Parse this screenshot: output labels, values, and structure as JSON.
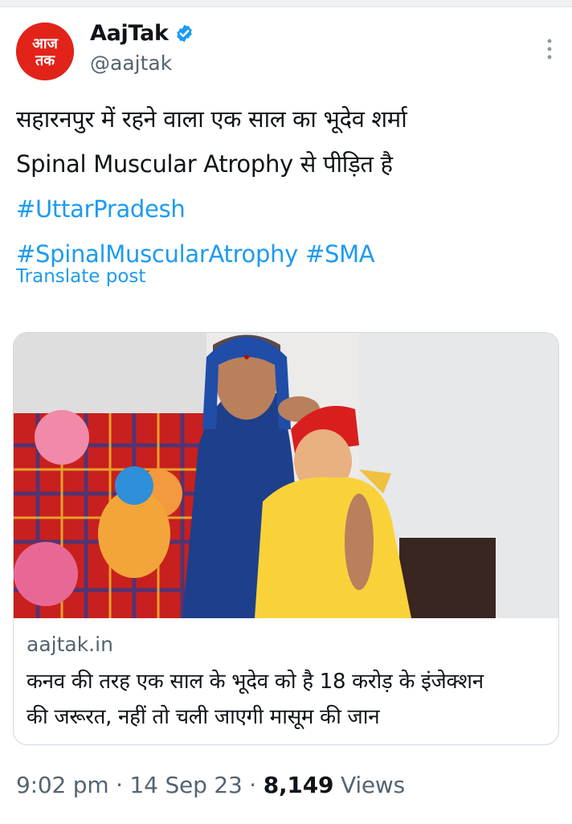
{
  "author": {
    "logo_text": "आज तक",
    "name": "AajTak",
    "handle": "@aajtak",
    "verified_icon": "verified-badge-icon",
    "more_icon": "more-vertical-icon"
  },
  "post": {
    "lines": [
      "सहारनपुर में रहने वाला एक साल का भूदेव शर्मा",
      "Spinal Muscular Atrophy से पीड़ित है"
    ],
    "hashtags": [
      "#UttarPradesh",
      "#SpinalMuscularAtrophy",
      "#SMA"
    ],
    "translate_label": "Translate post"
  },
  "card": {
    "domain": "aajtak.in",
    "title_lines": [
      "कनव की तरह एक साल के भूदेव को है 18 करोड़ के इंजेक्शन",
      "की जरूरत, नहीं तो चली जाएगी मासूम की जान"
    ]
  },
  "meta": {
    "time": "9:02 pm",
    "separator": "·",
    "date": "14 Sep 23",
    "views_count": "8,149",
    "views_label": "Views"
  },
  "colors": {
    "accent": "#1d9bf0",
    "brand_red": "#e2231a",
    "muted": "#536471"
  }
}
